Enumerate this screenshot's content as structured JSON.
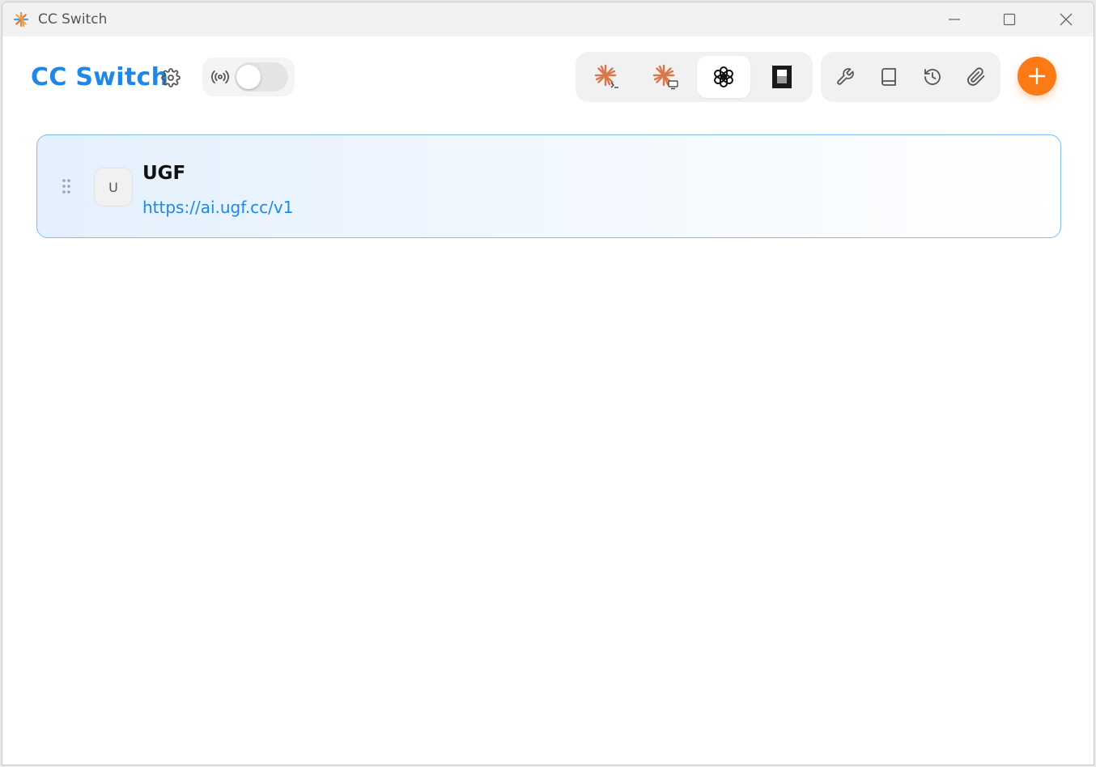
{
  "window": {
    "title": "CC Switch",
    "icon": "sparkle-app-icon"
  },
  "header": {
    "brand": "CC Switch",
    "settings_icon": "gear-icon",
    "proxy": {
      "icon": "radio-broadcast-icon",
      "enabled": false
    }
  },
  "app_tabs": [
    {
      "id": "claude-code",
      "icon": "claude-terminal-icon",
      "active": false
    },
    {
      "id": "claude-desktop",
      "icon": "claude-desktop-icon",
      "active": false
    },
    {
      "id": "codex",
      "icon": "openai-icon",
      "active": true
    },
    {
      "id": "gemini",
      "icon": "black-panel-icon",
      "active": false
    }
  ],
  "tools": [
    {
      "id": "tools",
      "icon": "wrench-icon"
    },
    {
      "id": "docs",
      "icon": "book-icon"
    },
    {
      "id": "history",
      "icon": "history-icon"
    },
    {
      "id": "attach",
      "icon": "paperclip-icon"
    }
  ],
  "add_button": {
    "icon": "plus-icon"
  },
  "providers": [
    {
      "avatar": "U",
      "name": "UGF",
      "url": "https://ai.ugf.cc/v1",
      "active": true
    }
  ],
  "colors": {
    "accent": "#1f87e8",
    "add_button": "#fb7a16",
    "claude_orange": "#d9774b",
    "card_border": "#7fbdf0"
  }
}
